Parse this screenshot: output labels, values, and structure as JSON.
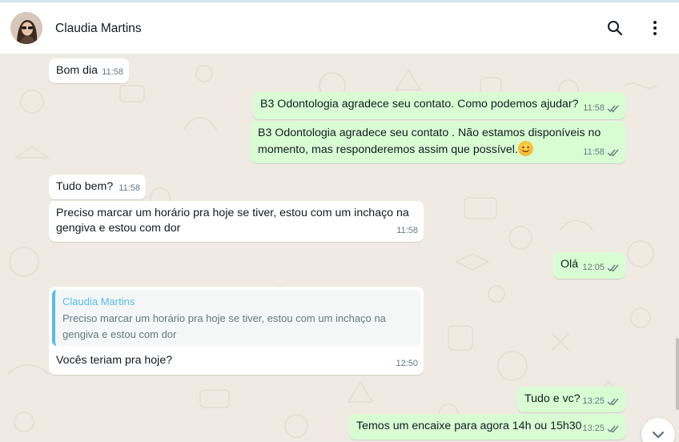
{
  "header": {
    "contact_name": "Claudia Martins",
    "avatar_icon": "profile-photo",
    "search_icon": "search-icon",
    "menu_icon": "kebab-menu-icon"
  },
  "colors": {
    "incoming": "#ffffff",
    "outgoing": "#d9fdd3",
    "quote_accent": "#53bdeb",
    "tick_read": "#667781"
  },
  "messages": [
    {
      "direction": "in",
      "text": "Bom dia",
      "time": "11:58"
    },
    {
      "direction": "out",
      "text": "B3 Odontologia agradece seu contato. Como podemos ajudar?",
      "time": "11:58",
      "status": "delivered"
    },
    {
      "direction": "out",
      "text_line1": "B3 Odontologia agradece seu contato . Não estamos disponíveis no",
      "text_line2": "momento, mas responderemos assim que possível.",
      "emoji": "smiling-face",
      "time": "11:58",
      "status": "delivered"
    },
    {
      "direction": "in",
      "text": "Tudo bem?",
      "time": "11:58"
    },
    {
      "direction": "in",
      "text_line1": "Preciso marcar um horário pra hoje se tiver, estou com um inchaço na",
      "text_line2": "gengiva e estou com dor",
      "time": "11:58"
    },
    {
      "direction": "out",
      "text": "Olá",
      "time": "12:05",
      "status": "delivered"
    },
    {
      "direction": "in",
      "quote": {
        "author": "Claudia Martins",
        "line1": "Preciso marcar um horário pra hoje se tiver, estou com um inchaço na",
        "line2": "gengiva e estou com dor"
      },
      "text": "Vocês teriam pra hoje?",
      "time": "12:50"
    },
    {
      "direction": "out",
      "text": "Tudo e vc?",
      "time": "13:25",
      "status": "delivered"
    },
    {
      "direction": "out",
      "text": "Temos um encaixe para agora 14h ou 15h30",
      "time": "13:25",
      "status": "delivered"
    }
  ]
}
